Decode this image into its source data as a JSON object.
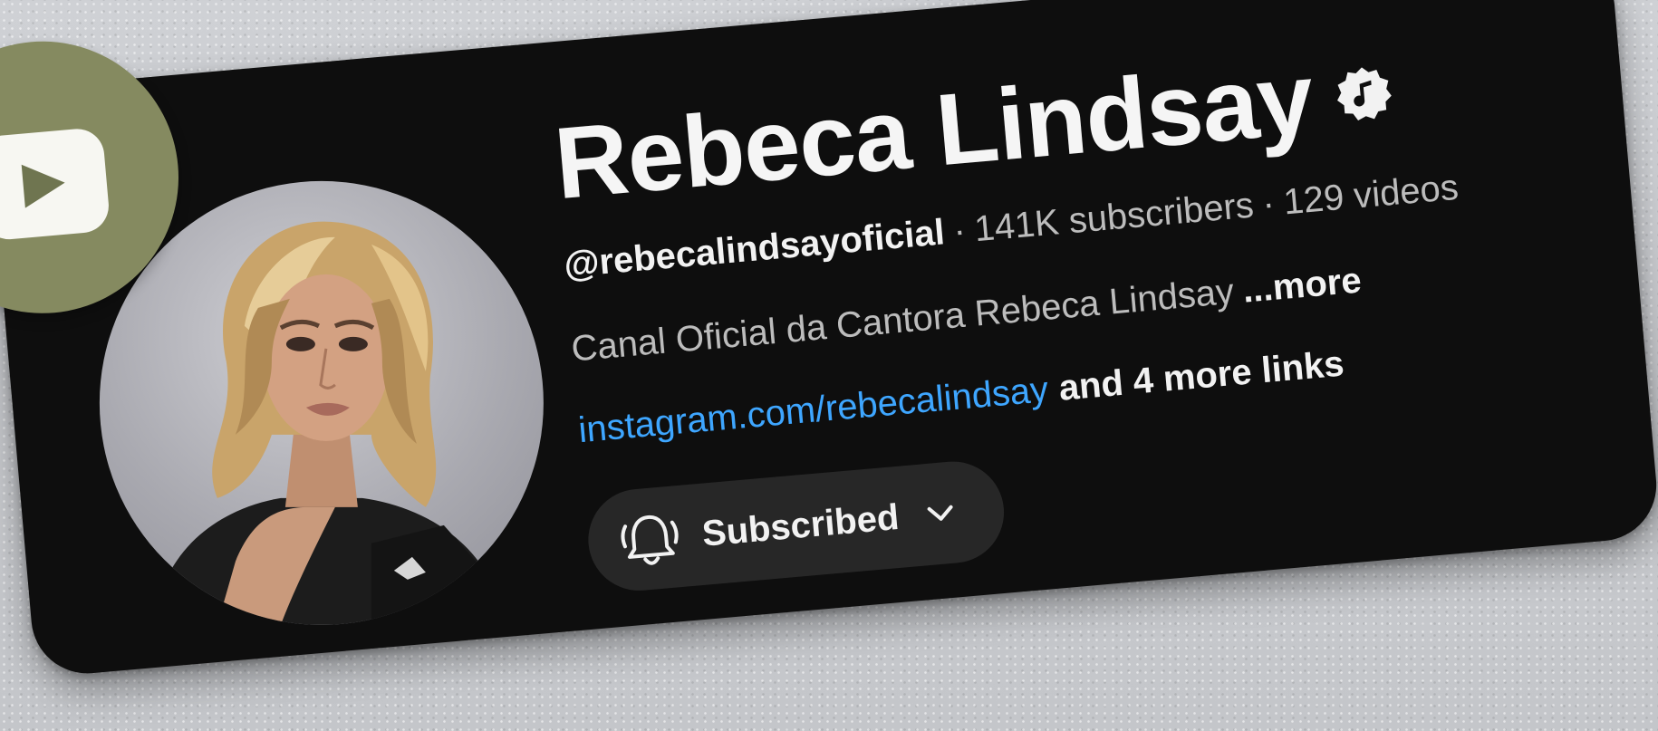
{
  "channel": {
    "name": "Rebeca Lindsay",
    "handle": "@rebecalindsayoficial",
    "separator": "·",
    "subscribers": "141K subscribers",
    "videos": "129 videos",
    "description": "Canal Oficial da Cantora Rebeca Lindsay",
    "more_label": "...more",
    "link": "instagram.com/rebecalindsay",
    "more_links": "and 4 more links"
  },
  "subscribe_button": {
    "label": "Subscribed"
  },
  "icons": {
    "logo": "play-icon",
    "verified": "music-note-badge-icon",
    "bell": "bell-ringing-icon",
    "chevron": "chevron-down-icon"
  },
  "colors": {
    "card_bg": "#0e0e0e",
    "badge_bg": "#858a60",
    "link": "#3ea6ff",
    "button_bg": "#272727",
    "page_bg": "#c9cbcf"
  }
}
